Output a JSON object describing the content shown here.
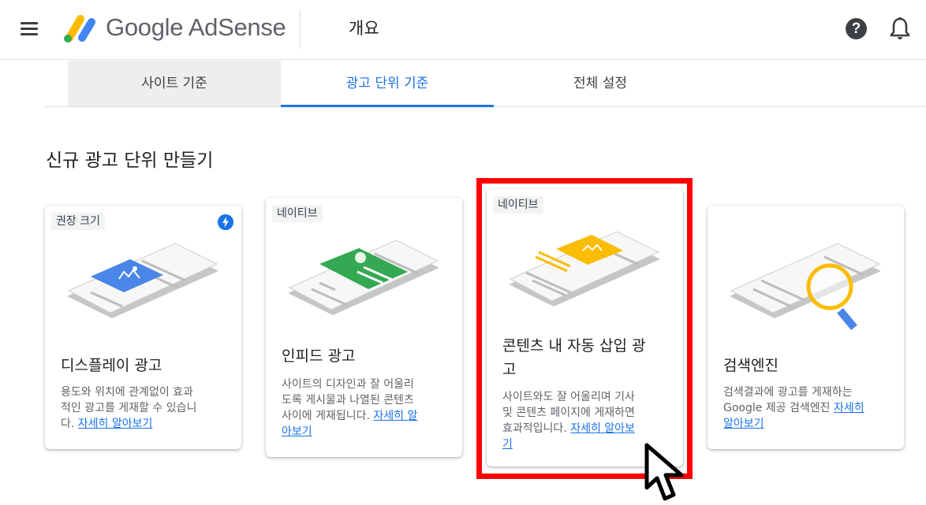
{
  "header": {
    "brand": "Google AdSense",
    "page_title": "개요",
    "help_label": "?"
  },
  "tabs": [
    {
      "label": "사이트 기준"
    },
    {
      "label": "광고 단위 기준"
    },
    {
      "label": "전체 설정"
    }
  ],
  "section_title": "신규 광고 단위 만들기",
  "cards": [
    {
      "badge": "권장 크기",
      "title": "디스플레이 광고",
      "desc_lines": [
        "용도와 위치에 관계없이 효과",
        "적인 광고를 게재할 수 있습니",
        "다. "
      ],
      "link": "자세히 알아보기"
    },
    {
      "badge": "네이티브",
      "title": "인피드 광고",
      "desc_lines": [
        "사이트의 디자인과 잘 어울리",
        "도록 게시물과 나열된 콘텐츠",
        "사이에 게재됩니다. "
      ],
      "link_part1": "자세히 알",
      "link_part2": "아보기"
    },
    {
      "badge": "네이티브",
      "title_lines": [
        "콘텐츠 내 자동 삽입 광",
        "고"
      ],
      "desc_lines": [
        "사이트와도 잘 어울리며 기사",
        "및 콘텐츠 페이지에 게재하면",
        "효과적입니다. "
      ],
      "link_part1": "자세히 알아보",
      "link_part2": "기"
    },
    {
      "title": "검색엔진",
      "desc_lines": [
        "검색결과에 광고를 게재하는",
        "Google 제공 검색엔진 "
      ],
      "link_part1": "자세히",
      "link_part2": "알아보기"
    }
  ],
  "colors": {
    "accent": "#1a73e8",
    "highlight": "#ff0000",
    "logo_yellow": "#fbbc04",
    "logo_blue": "#4285f4",
    "logo_green": "#34a853",
    "illus_blue": "#4a86e8",
    "illus_green": "#34a853",
    "illus_yellow": "#fbbc04"
  },
  "icons": [
    "menu-icon",
    "adsense-logo-icon",
    "help-icon",
    "bell-icon",
    "bolt-icon",
    "mouse-cursor-icon"
  ]
}
